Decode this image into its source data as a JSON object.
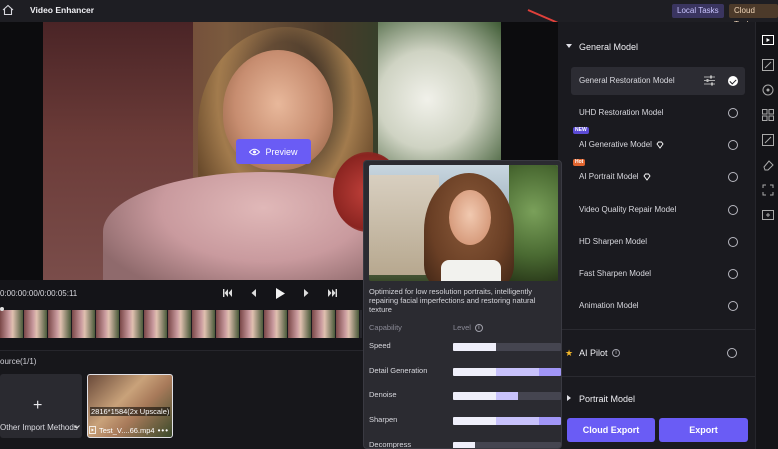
{
  "app": {
    "title": "Video Enhancer",
    "local_tasks": "Local Tasks",
    "cloud_task": "Cloud Task"
  },
  "preview": {
    "button_label": "Preview",
    "timecode": "0:00:00:00/0:00:05:11"
  },
  "source": {
    "label": "ource(1/1)",
    "import_label": "Other Import Methods",
    "file_resolution": "2816*1584(2x Upscale)",
    "file_name": "Test_V....66.mp4"
  },
  "popover": {
    "description": "Optimized for low resolution portraits, intelligently repairing facial imperfections and restoring natural texture",
    "capability_header": "Capability",
    "level_header": "Level",
    "capabilities": [
      {
        "name": "Speed",
        "level": 2
      },
      {
        "name": "Detail Generation",
        "level": 5
      },
      {
        "name": "Denoise",
        "level": 3
      },
      {
        "name": "Sharpen",
        "level": 5
      },
      {
        "name": "Decompress",
        "level": 1
      }
    ]
  },
  "models": {
    "general_title": "General Model",
    "items": [
      {
        "label": "General Restoration Model",
        "selected": true
      },
      {
        "label": "UHD Restoration Model",
        "selected": false
      },
      {
        "label": "AI Generative Model",
        "badge": "NEW",
        "selected": false
      },
      {
        "label": "AI Portrait Model",
        "badge": "Hot",
        "selected": false
      },
      {
        "label": "Video Quality Repair Model",
        "selected": false
      },
      {
        "label": "HD Sharpen Model",
        "selected": false
      },
      {
        "label": "Fast Sharpen Model",
        "selected": false
      },
      {
        "label": "Animation Model",
        "selected": false
      }
    ],
    "ai_pilot": "AI Pilot",
    "portrait_title": "Portrait Model"
  },
  "actions": {
    "cloud_export": "Cloud Export",
    "export": "Export"
  },
  "colors": {
    "accent": "#6a5cf5",
    "level_light": "#efeffa",
    "level_mid": "#c8c2fb",
    "level_strong": "#a196f7",
    "annotation": "#e0403a"
  }
}
